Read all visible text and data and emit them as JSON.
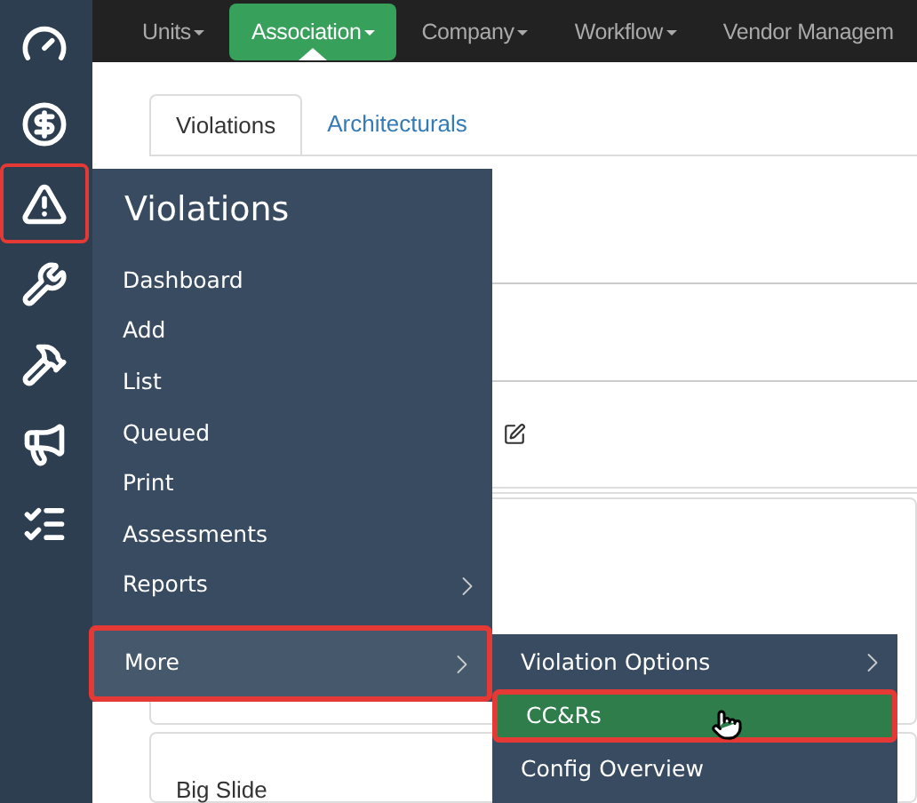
{
  "sidebar": {
    "items": [
      {
        "kind": "gauge",
        "selected": false
      },
      {
        "kind": "dollar",
        "selected": false
      },
      {
        "kind": "warning",
        "selected": true
      },
      {
        "kind": "wrench",
        "selected": false
      },
      {
        "kind": "hammer",
        "selected": false
      },
      {
        "kind": "megaphone",
        "selected": false
      },
      {
        "kind": "checklist",
        "selected": false
      }
    ]
  },
  "nav": {
    "items": [
      {
        "label": "Units",
        "selected": false
      },
      {
        "label": "Association",
        "selected": true
      },
      {
        "label": "Company",
        "selected": false
      },
      {
        "label": "Workflow",
        "selected": false
      },
      {
        "label": "Vendor Managem",
        "selected": false
      }
    ]
  },
  "tabs": [
    {
      "label": "Violations",
      "selected": true
    },
    {
      "label": "Architecturals",
      "selected": false
    }
  ],
  "content": {
    "card_title": "Big Slide"
  },
  "flyout": {
    "title": "Violations",
    "items": [
      {
        "label": "Dashboard",
        "submenu": false,
        "selected": false
      },
      {
        "label": "Add",
        "submenu": false,
        "selected": false
      },
      {
        "label": "List",
        "submenu": false,
        "selected": false
      },
      {
        "label": "Queued",
        "submenu": false,
        "selected": false
      },
      {
        "label": "Print",
        "submenu": false,
        "selected": false
      },
      {
        "label": "Assessments",
        "submenu": false,
        "selected": false
      },
      {
        "label": "Reports",
        "submenu": true,
        "selected": false
      },
      {
        "label": "More",
        "submenu": true,
        "selected": true
      }
    ]
  },
  "submenu": {
    "items": [
      {
        "label": "Violation Options",
        "submenu": true,
        "selected": false
      },
      {
        "label": "CC&Rs",
        "submenu": false,
        "selected": true
      },
      {
        "label": "Config Overview",
        "submenu": false,
        "selected": false
      }
    ]
  }
}
